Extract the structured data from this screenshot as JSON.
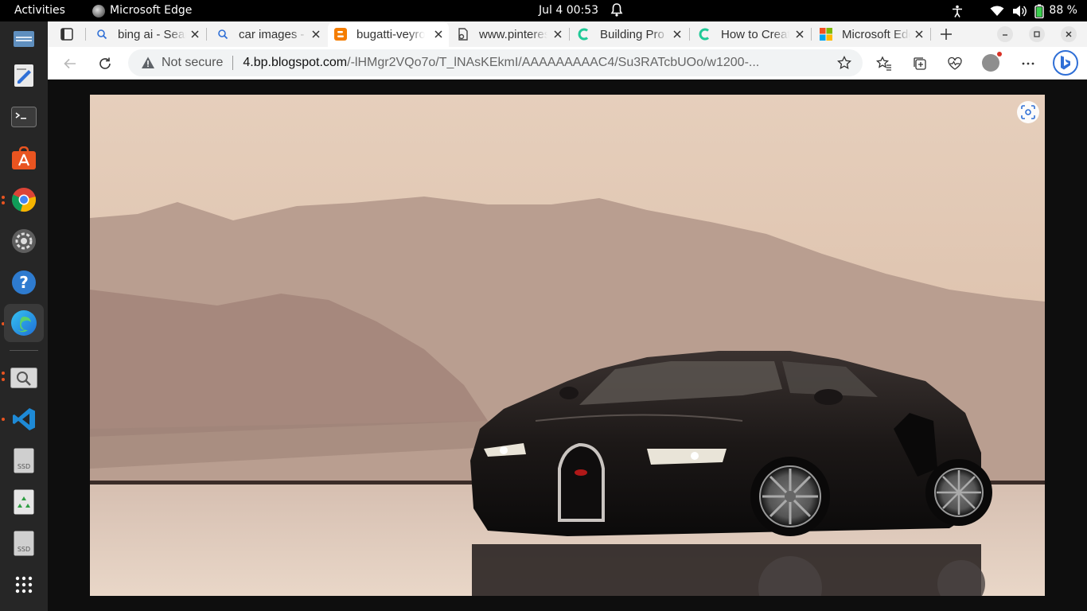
{
  "topbar": {
    "activities": "Activities",
    "app_name": "Microsoft Edge",
    "clock": "Jul 4  00:53",
    "battery": "88 %"
  },
  "dock": {
    "items": [
      "files",
      "text-editor",
      "terminal",
      "app-center",
      "chrome",
      "settings",
      "help",
      "edge",
      "image-viewer",
      "vscode",
      "ssd-drive",
      "trash",
      "ssd-drive",
      "show-apps"
    ],
    "drive_label": "SSD"
  },
  "browser": {
    "tabs": [
      {
        "title": "bing ai - Search",
        "icon": "search-icon",
        "active": false
      },
      {
        "title": "car images - Search",
        "icon": "search-icon",
        "active": false
      },
      {
        "title": "bugatti-veyron",
        "icon": "blogger-icon",
        "active": true
      },
      {
        "title": "www.pinterest",
        "icon": "page-icon",
        "active": false
      },
      {
        "title": "Building Pro",
        "icon": "c-icon",
        "active": false
      },
      {
        "title": "How to Create",
        "icon": "c-icon",
        "active": false
      },
      {
        "title": "Microsoft Edge",
        "icon": "microsoft-icon",
        "active": false
      }
    ],
    "address": {
      "security": "Not secure",
      "host": "4.bp.blogspot.com",
      "path": "/-lHMgr2VQo7o/T_lNAsKEkmI/AAAAAAAAAC4/Su3RATcbUOo/w1200-..."
    }
  },
  "colors": {
    "accent": "#e95420",
    "edge_blue": "#2f6fd6",
    "sky_top": "#e8d1bd",
    "sky_bottom": "#c9a78f",
    "mountain": "#9d8177"
  }
}
